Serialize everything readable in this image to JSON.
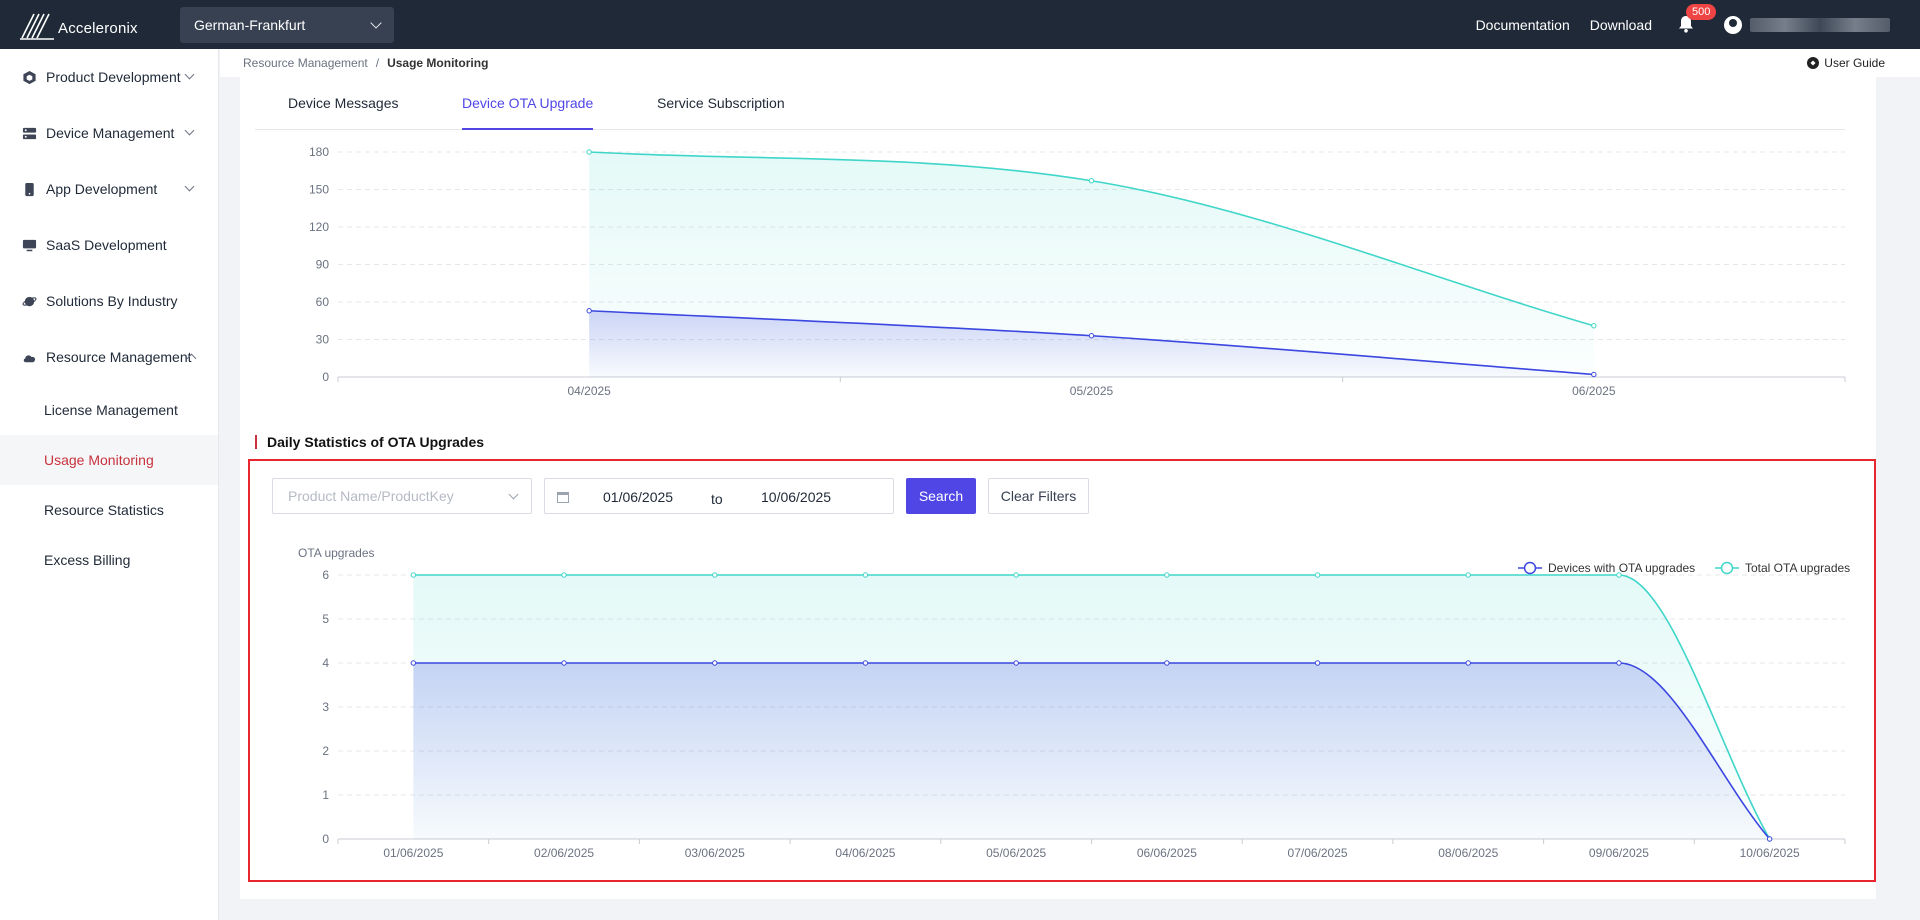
{
  "header": {
    "logo_text": "Acceleronix",
    "region": "German-Frankfurt",
    "links": [
      "Documentation",
      "Download"
    ],
    "notification_count": "500"
  },
  "sidebar": {
    "items": [
      {
        "label": "Product Development",
        "icon": "cube-icon"
      },
      {
        "label": "Device Management",
        "icon": "server-icon"
      },
      {
        "label": "App Development",
        "icon": "phone-icon"
      },
      {
        "label": "SaaS Development",
        "icon": "monitor-icon"
      },
      {
        "label": "Solutions By Industry",
        "icon": "planet-icon"
      },
      {
        "label": "Resource Management",
        "icon": "cloud-icon"
      }
    ],
    "sub_items": [
      "License Management",
      "Usage Monitoring",
      "Resource Statistics",
      "Excess Billing"
    ]
  },
  "breadcrumb": {
    "parent": "Resource Management",
    "current": "Usage Monitoring",
    "sep": "/"
  },
  "user_guide": "User Guide",
  "tabs": [
    "Device Messages",
    "Device OTA Upgrade",
    "Service Subscription"
  ],
  "section_title": "Daily Statistics of OTA Upgrades",
  "filters": {
    "product_placeholder": "Product Name/ProductKey",
    "date_from": "01/06/2025",
    "date_to": "10/06/2025",
    "to_label": "to",
    "search_label": "Search",
    "clear_label": "Clear Filters"
  },
  "colors": {
    "accent": "#4f46e5",
    "active_red": "#c8323c",
    "series_devices": "#3b47e0",
    "series_total": "#3fd6c9"
  },
  "chart_data": [
    {
      "type": "area",
      "categories": [
        "04/2025",
        "05/2025",
        "06/2025"
      ],
      "series": [
        {
          "values": [
            180,
            157,
            41
          ]
        },
        {
          "values": [
            53,
            33,
            2
          ]
        }
      ],
      "yticks": [
        0,
        30,
        60,
        90,
        120,
        150,
        180
      ],
      "ylim": [
        0,
        180
      ],
      "grid": true
    },
    {
      "type": "area",
      "ylabel": "OTA upgrades",
      "categories": [
        "01/06/2025",
        "02/06/2025",
        "03/06/2025",
        "04/06/2025",
        "05/06/2025",
        "06/06/2025",
        "07/06/2025",
        "08/06/2025",
        "09/06/2025",
        "10/06/2025"
      ],
      "series": [
        {
          "name": "Devices with OTA upgrades",
          "values": [
            4,
            4,
            4,
            4,
            4,
            4,
            4,
            4,
            4,
            0
          ]
        },
        {
          "name": "Total OTA upgrades",
          "values": [
            6,
            6,
            6,
            6,
            6,
            6,
            6,
            6,
            6,
            0
          ]
        }
      ],
      "yticks": [
        0,
        1,
        2,
        3,
        4,
        5,
        6
      ],
      "ylim": [
        0,
        6
      ],
      "legend": "top-right",
      "grid": true
    }
  ]
}
